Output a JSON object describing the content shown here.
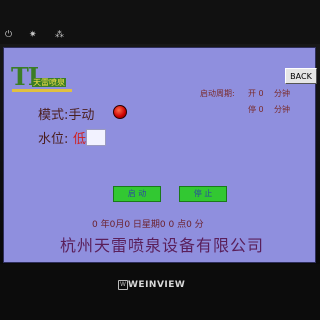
{
  "device": {
    "icons": [
      "power-icon",
      "brightness-icon",
      "network-icon"
    ],
    "brand": "WEINVIEW"
  },
  "screen": {
    "logo": {
      "letters": "TL",
      "sub": "天雷喷泉"
    },
    "back_label": "BACK",
    "period": {
      "label": "启动周期:",
      "on_value": "开 0",
      "on_unit": "分钟",
      "off_value": "停 0",
      "off_unit": "分钟"
    },
    "mode": {
      "label": "模式:手动"
    },
    "level": {
      "label": "水位:",
      "value": "低"
    },
    "start_label": "启 动",
    "stop_label": "停 止",
    "datetime": "0 年0月0 日星期0  0 点0 分",
    "company": "杭州天雷喷泉设备有限公司"
  }
}
